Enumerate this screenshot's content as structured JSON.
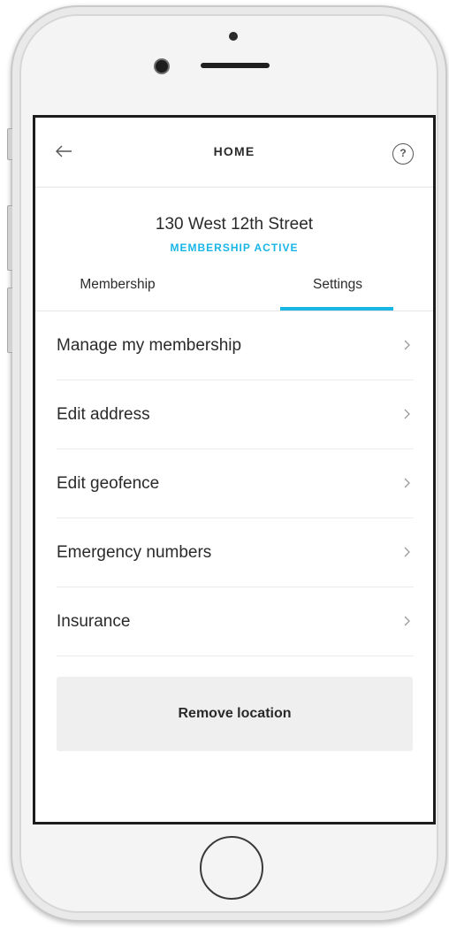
{
  "header": {
    "title": "HOME",
    "back_icon": "arrow-left-icon",
    "help_label": "?"
  },
  "location": {
    "address": "130 West 12th Street",
    "status": "MEMBERSHIP ACTIVE",
    "status_color": "#18b6e6"
  },
  "tabs": [
    {
      "label": "Membership",
      "selected": false
    },
    {
      "label": "Settings",
      "selected": true
    }
  ],
  "settings_menu": [
    {
      "label": "Manage my membership",
      "icon": "chevron-right-icon"
    },
    {
      "label": "Edit address",
      "icon": "chevron-right-icon"
    },
    {
      "label": "Edit geofence",
      "icon": "chevron-right-icon"
    },
    {
      "label": "Emergency numbers",
      "icon": "chevron-right-icon"
    },
    {
      "label": "Insurance",
      "icon": "chevron-right-icon"
    }
  ],
  "actions": {
    "remove_label": "Remove location"
  }
}
